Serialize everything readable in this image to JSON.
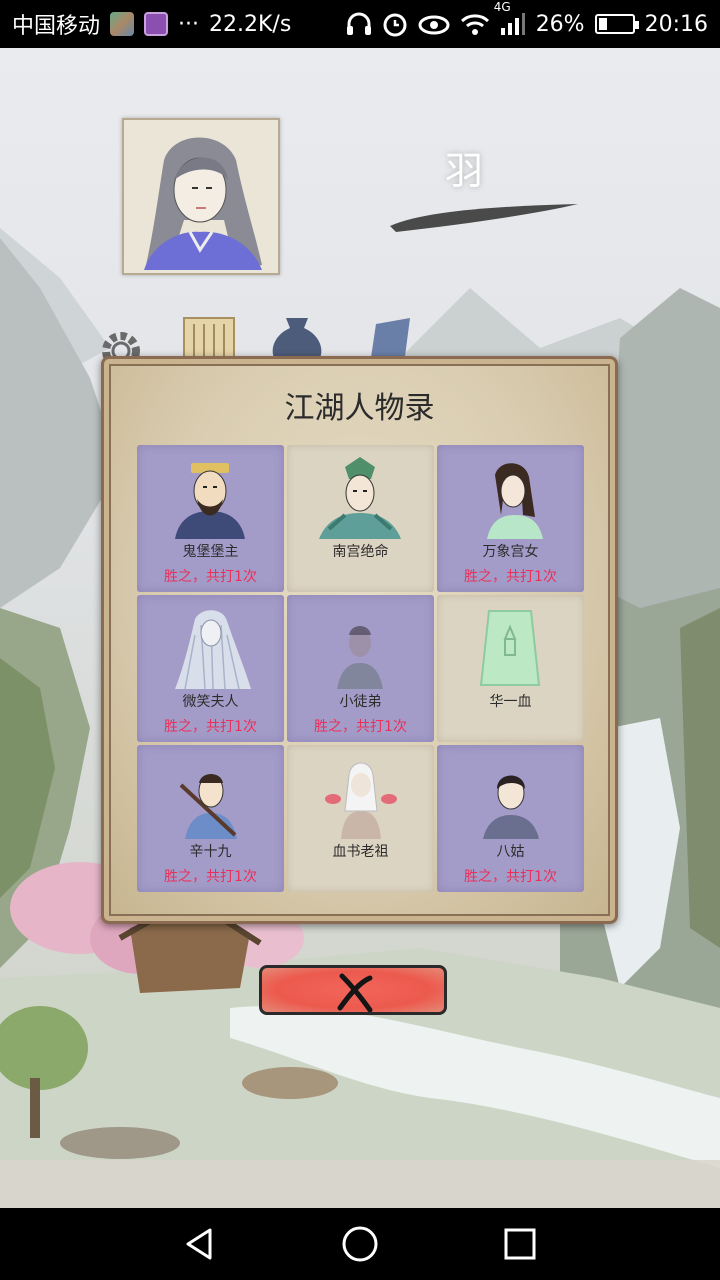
{
  "status_bar": {
    "carrier": "中国移动",
    "net_speed": "22.2K/s",
    "network_type": "4G",
    "battery_percent": "26%",
    "battery_level": 0.26,
    "time": "20:16",
    "icons": [
      "app-thumbnail-icon",
      "gallery-icon",
      "more-icon",
      "headphones-icon",
      "alarm-icon",
      "eye-icon",
      "wifi-icon",
      "signal-icon",
      "battery-icon"
    ]
  },
  "player": {
    "name": "羽"
  },
  "top_menu": {
    "icons": [
      "gear-icon",
      "scroll-icon",
      "pouch-icon",
      "book-icon"
    ]
  },
  "dialog": {
    "title": "江湖人物录",
    "characters": [
      {
        "name": "鬼堡堡主",
        "record": "胜之，共打1次",
        "defeated": true,
        "icon": "bearded-lord-icon"
      },
      {
        "name": "南宫绝命",
        "record": "",
        "defeated": false,
        "icon": "green-warrior-icon"
      },
      {
        "name": "万象宫女",
        "record": "胜之，共打1次",
        "defeated": true,
        "icon": "palace-maid-icon"
      },
      {
        "name": "微笑夫人",
        "record": "胜之，共打1次",
        "defeated": true,
        "icon": "ghost-lady-icon"
      },
      {
        "name": "小徒弟",
        "record": "胜之，共打1次",
        "defeated": true,
        "icon": "apprentice-icon"
      },
      {
        "name": "华一血",
        "record": "",
        "defeated": false,
        "icon": "jade-tablet-icon"
      },
      {
        "name": "辛十九",
        "record": "胜之，共打1次",
        "defeated": true,
        "icon": "swordsman-icon"
      },
      {
        "name": "血书老祖",
        "record": "",
        "defeated": false,
        "icon": "elder-icon"
      },
      {
        "name": "八姑",
        "record": "胜之，共打1次",
        "defeated": true,
        "icon": "young-girl-icon"
      }
    ],
    "close_icon": "close-x-icon"
  },
  "bottom_nav": {
    "icons": [
      "pavilion-icon",
      "armor-icon",
      "chest-icon",
      "blades-icon",
      "manual-icon",
      "companions-icon"
    ]
  },
  "android_nav": {
    "icons": [
      "back-icon",
      "home-icon",
      "recents-icon"
    ]
  }
}
